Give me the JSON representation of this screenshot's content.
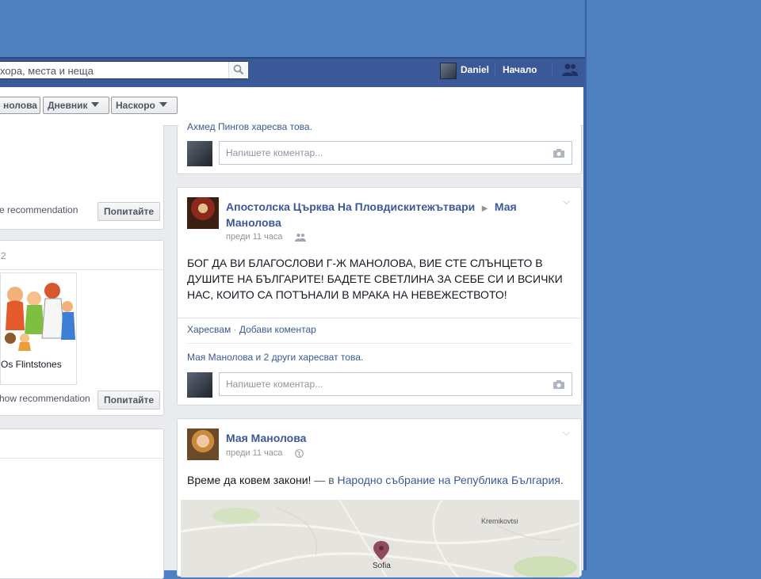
{
  "header": {
    "search_placeholder": "хора, места и неща",
    "user_name": "Daniel",
    "home_label": "Начало"
  },
  "subnav": {
    "tabs": [
      "нолова",
      "Дневник",
      "Наскоро"
    ]
  },
  "left": {
    "card1": {
      "recommendation_text": "e recommendation",
      "button_label": "Попитайте"
    },
    "card2": {
      "header_text": "2",
      "image_caption": "Os Flintstones",
      "recommendation_text": "how recommendation",
      "button_label": "Попитайте"
    }
  },
  "feed": {
    "post0": {
      "likes_text": "Ахмед Пингов харесва това.",
      "comment_placeholder": "Напишете коментар..."
    },
    "post1": {
      "author": "Апостолска Църква На Пловдискитежътвари",
      "target": "Мая Манолова",
      "time": "преди 11 часа",
      "text": "БОГ ДА ВИ БЛАГОСЛОВИ Г-Ж МАНОЛОВА, ВИЕ СТЕ СЛЪНЦЕТО В ДУШИТЕ НА БЪЛГАРИТЕ! БАДЕТЕ СВЕТЛИНА ЗА СЕБЕ СИ И ВСИЧКИ НАС, КОИТО СА ПОТЪНАЛИ В МРАКА НА НЕВЕЖЕСТВОТО!",
      "action_like": "Харесвам",
      "action_sep": " · ",
      "action_comment": "Добави коментар",
      "likes_link": "Мая Манолова",
      "likes_mid": " и ",
      "likes_others": "2 други",
      "likes_end": " харесват това.",
      "comment_placeholder": "Напишете коментар..."
    },
    "post2": {
      "author": "Мая Манолова",
      "time": "преди 11 часа",
      "text": "Време да ковем закони!",
      "text_mid": " — в ",
      "place": "Народно събрание на Република България",
      "place_end": ".",
      "map_labels": {
        "town1": "Kremikovtsi",
        "city": "Sofia"
      }
    }
  },
  "colors": {
    "bluebar": "#3b5998",
    "outer_blue": "#4e80bf",
    "link": "#3b5998"
  }
}
